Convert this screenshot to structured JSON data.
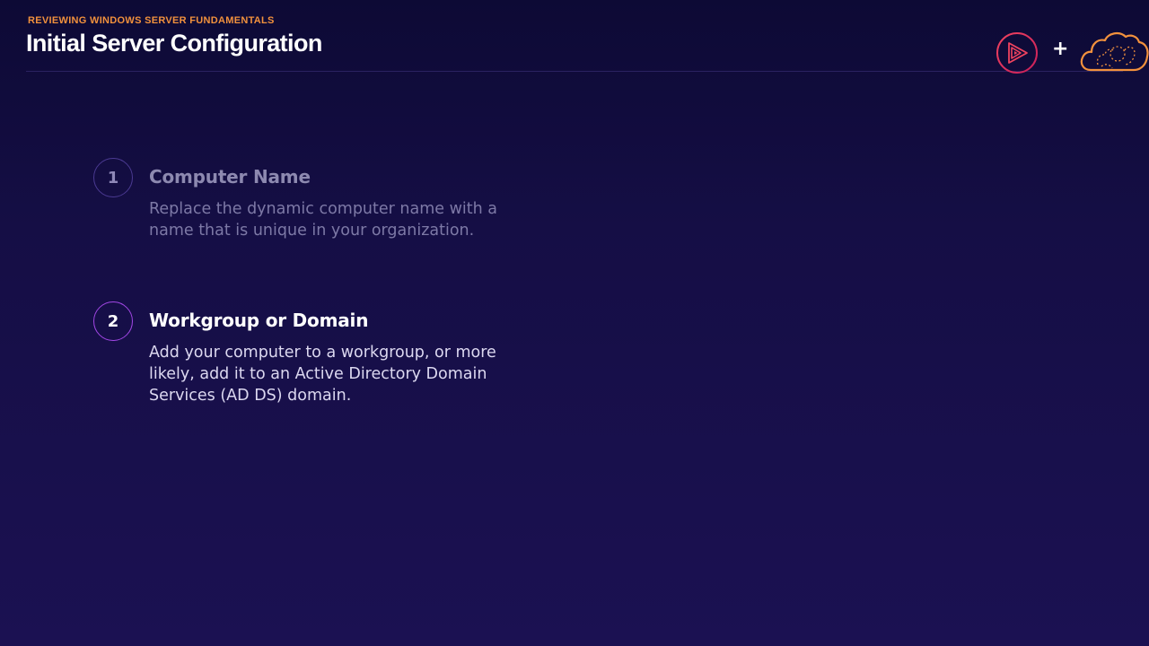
{
  "header": {
    "eyebrow": "REVIEWING WINDOWS SERVER FUNDAMENTALS",
    "title": "Initial Server Configuration",
    "plus": "+"
  },
  "logos": [
    {
      "icon": "play-logo-icon"
    },
    {
      "icon": "cloud-logo-icon"
    }
  ],
  "items": [
    {
      "number": "1",
      "title": "Computer Name",
      "description": "Replace the dynamic computer name with a name that is unique in your organization.",
      "state": "dim"
    },
    {
      "number": "2",
      "title": "Workgroup or Domain",
      "description": "Add your computer to a workgroup, or more likely, add it to an Active Directory Domain Services (AD DS) domain.",
      "state": "active"
    }
  ],
  "colors": {
    "accent_orange": "#f2913d",
    "accent_pink": "#e8314f",
    "accent_purple": "#a247e6",
    "background": "#150e45"
  }
}
